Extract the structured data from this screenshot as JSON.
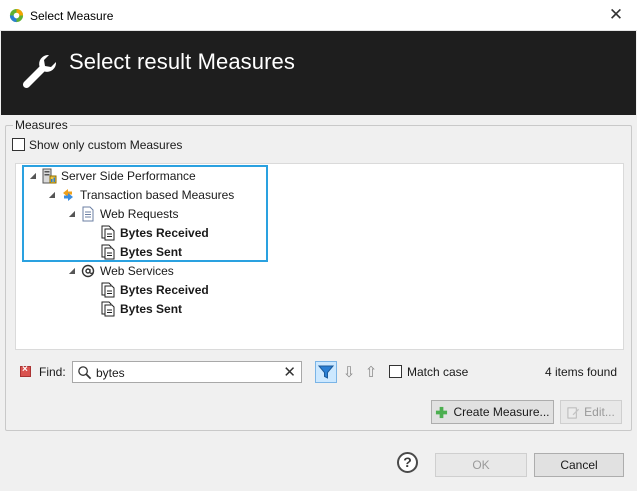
{
  "window": {
    "title": "Select Measure",
    "close_glyph": "✕"
  },
  "banner": {
    "heading": "Select result Measures",
    "icon": "wrench-icon"
  },
  "measures_group": {
    "label": "Measures",
    "show_custom_label": "Show only custom Measures",
    "show_custom_checked": false
  },
  "tree": {
    "root_label": "Server Side Performance",
    "transaction_label": "Transaction based Measures",
    "web_requests_label": "Web Requests",
    "web_requests_children": [
      "Bytes Received",
      "Bytes Sent"
    ],
    "web_services_label": "Web Services",
    "web_services_children": [
      "Bytes Received",
      "Bytes Sent"
    ]
  },
  "find": {
    "label": "Find:",
    "value": "bytes",
    "clear_glyph": "✕",
    "match_case_label": "Match case",
    "match_case_checked": false,
    "result_text": "4 items found"
  },
  "actions": {
    "create_label": "Create Measure...",
    "edit_label": "Edit...",
    "ok_label": "OK",
    "cancel_label": "Cancel",
    "help_glyph": "?"
  },
  "colors": {
    "banner_bg": "#1e1e1e",
    "highlight": "#2aa1e0",
    "filter_active": "#cce8ff"
  }
}
